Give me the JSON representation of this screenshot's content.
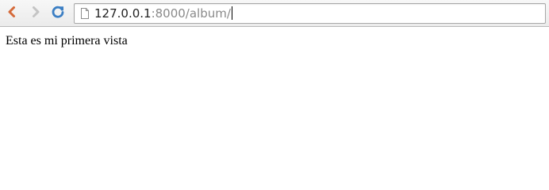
{
  "browser": {
    "omnibox": {
      "url_host": "127.0.0.1",
      "url_rest": ":8000/album/"
    },
    "icons": {
      "back": "back-arrow-icon",
      "forward": "forward-arrow-icon",
      "reload": "reload-icon",
      "page": "page-icon"
    },
    "colors": {
      "back_arrow": "#d56a3a",
      "forward_arrow": "#c4c4c4",
      "reload": "#3c7fc4"
    }
  },
  "page": {
    "body_text": "Esta es mi primera vista"
  }
}
